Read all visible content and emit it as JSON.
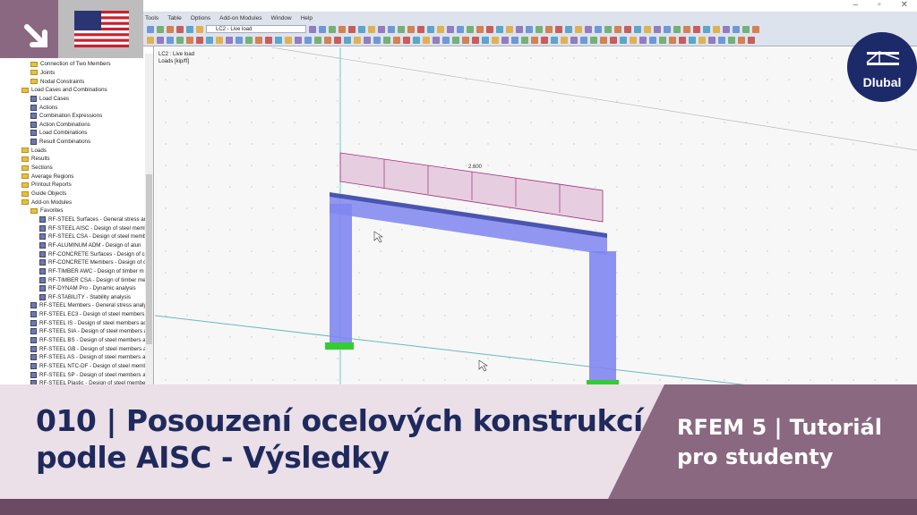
{
  "menu": [
    "Tools",
    "Table",
    "Options",
    "Add-on Modules",
    "Window",
    "Help"
  ],
  "toolbar": {
    "load_case": "LC2 - Live load"
  },
  "viewport": {
    "label_line1": "LC2 : Live load",
    "label_line2": "Loads [kip/ft]",
    "load_value": "2.600"
  },
  "tree": [
    {
      "label": "Connection of Two Members",
      "lvl": 2,
      "icon": "folder"
    },
    {
      "label": "Joints",
      "lvl": 2,
      "icon": "folder"
    },
    {
      "label": "Nodal Constraints",
      "lvl": 2,
      "icon": "folder"
    },
    {
      "label": "Load Cases and Combinations",
      "lvl": 1,
      "icon": "folder"
    },
    {
      "label": "Load Cases",
      "lvl": 2,
      "icon": "mod"
    },
    {
      "label": "Actions",
      "lvl": 2,
      "icon": "mod"
    },
    {
      "label": "Combination Expressions",
      "lvl": 2,
      "icon": "mod"
    },
    {
      "label": "Action Combinations",
      "lvl": 2,
      "icon": "mod"
    },
    {
      "label": "Load Combinations",
      "lvl": 2,
      "icon": "mod"
    },
    {
      "label": "Result Combinations",
      "lvl": 2,
      "icon": "mod"
    },
    {
      "label": "Loads",
      "lvl": 1,
      "icon": "folder"
    },
    {
      "label": "Results",
      "lvl": 1,
      "icon": "folder"
    },
    {
      "label": "Sections",
      "lvl": 1,
      "icon": "folder"
    },
    {
      "label": "Average Regions",
      "lvl": 1,
      "icon": "folder"
    },
    {
      "label": "Printout Reports",
      "lvl": 1,
      "icon": "folder"
    },
    {
      "label": "Guide Objects",
      "lvl": 1,
      "icon": "folder"
    },
    {
      "label": "Add-on Modules",
      "lvl": 1,
      "icon": "folder"
    },
    {
      "label": "Favorites",
      "lvl": 2,
      "icon": "folder"
    },
    {
      "label": "RF-STEEL Surfaces - General stress ana",
      "lvl": 3,
      "icon": "mod"
    },
    {
      "label": "RF-STEEL AISC - Design of steel memb",
      "lvl": 3,
      "icon": "mod"
    },
    {
      "label": "RF-STEEL CSA - Design of steel memb",
      "lvl": 3,
      "icon": "mod"
    },
    {
      "label": "RF-ALUMINUM ADM - Design of alun",
      "lvl": 3,
      "icon": "mod"
    },
    {
      "label": "RF-CONCRETE Surfaces - Design of cc",
      "lvl": 3,
      "icon": "mod"
    },
    {
      "label": "RF-CONCRETE Members - Design of c",
      "lvl": 3,
      "icon": "mod"
    },
    {
      "label": "RF-TIMBER AWC - Design of timber m",
      "lvl": 3,
      "icon": "mod"
    },
    {
      "label": "RF-TIMBER CSA - Design of timber me",
      "lvl": 3,
      "icon": "mod"
    },
    {
      "label": "RF-DYNAM Pro - Dynamic analysis",
      "lvl": 3,
      "icon": "mod"
    },
    {
      "label": "RF-STABILITY - Stability analysis",
      "lvl": 3,
      "icon": "mod"
    },
    {
      "label": "RF-STEEL Members - General stress analys",
      "lvl": 2,
      "icon": "mod"
    },
    {
      "label": "RF-STEEL EC3 - Design of steel members a",
      "lvl": 2,
      "icon": "mod"
    },
    {
      "label": "RF-STEEL IS - Design of steel members acc",
      "lvl": 2,
      "icon": "mod"
    },
    {
      "label": "RF-STEEL SIA - Design of steel members a",
      "lvl": 2,
      "icon": "mod"
    },
    {
      "label": "RF-STEEL BS - Design of steel members ac",
      "lvl": 2,
      "icon": "mod"
    },
    {
      "label": "RF-STEEL GB - Design of steel members a",
      "lvl": 2,
      "icon": "mod"
    },
    {
      "label": "RF-STEEL AS - Design of steel members ac",
      "lvl": 2,
      "icon": "mod"
    },
    {
      "label": "RF-STEEL NTC-DF - Design of steel memb",
      "lvl": 2,
      "icon": "mod"
    },
    {
      "label": "RF-STEEL SP - Design of steel members ac",
      "lvl": 2,
      "icon": "mod"
    },
    {
      "label": "RF-STEEL Plastic - Design of steel membe",
      "lvl": 2,
      "icon": "mod"
    }
  ],
  "logo": {
    "text": "Dlubal"
  },
  "banner": {
    "title_line1": "010 | Posouzení ocelových konstrukcí",
    "title_line2": "podle AISC - Výsledky",
    "series_line1": "RFEM 5 | Tutoriál",
    "series_line2": "pro studenty"
  },
  "colors": {
    "purple": "#8a6880",
    "light": "#ebdfe8",
    "navy": "#1f2a5c",
    "member": "#7f86f0",
    "load": "#a0307a"
  }
}
